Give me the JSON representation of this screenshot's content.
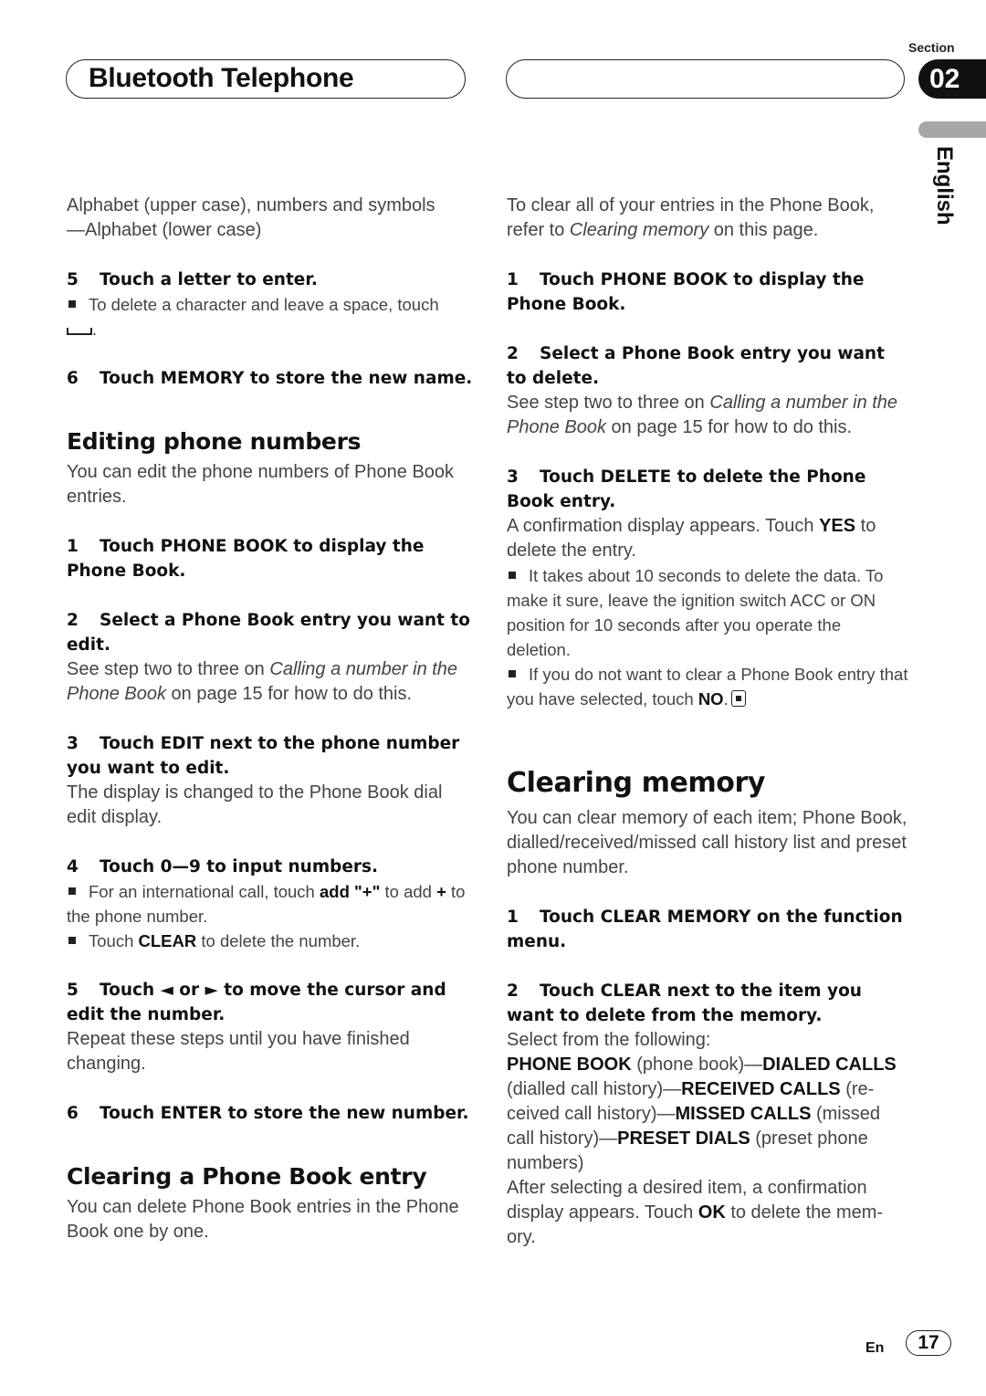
{
  "header": {
    "title": "Bluetooth Telephone",
    "section_label": "Section",
    "section_number": "02",
    "language": "English"
  },
  "left_column": {
    "intro": [
      [
        {
          "t": "Alphabet (upper case), numbers and symbols"
        }
      ],
      [
        {
          "t": "—Alphabet (lower case)"
        }
      ]
    ],
    "step5": {
      "num": "5",
      "text": "Touch a letter to enter."
    },
    "step5_note": [
      {
        "t": "To delete a character and leave a space, touch"
      }
    ],
    "step6": {
      "num": "6",
      "text": "Touch MEMORY to store the new name."
    },
    "editing": {
      "heading": "Editing phone numbers",
      "desc": "You can edit the phone numbers of Phone Book entries.",
      "step1": {
        "num": "1",
        "text": "Touch PHONE BOOK to display the Phone Book."
      },
      "step2": {
        "num": "2",
        "text": "Select a Phone Book entry you want to edit."
      },
      "step2_body": [
        {
          "t": "See step two to three on "
        },
        {
          "t": "Calling a number in the Phone Book",
          "i": true
        },
        {
          "t": " on page 15 for how to do this."
        }
      ],
      "step3": {
        "num": "3",
        "text": "Touch EDIT next to the phone number you want to edit."
      },
      "step3_body": "The display is changed to the Phone Book dial edit display.",
      "step4": {
        "num": "4",
        "text": "Touch 0—9 to input numbers."
      },
      "step4_notes": [
        [
          {
            "t": "For an international call, touch "
          },
          {
            "t": "add \"+\"",
            "b": true
          },
          {
            "t": " to add "
          },
          {
            "t": "+",
            "b": true
          },
          {
            "t": " to the phone number."
          }
        ],
        [
          {
            "t": "Touch "
          },
          {
            "t": "CLEAR",
            "b": true
          },
          {
            "t": " to delete the number."
          }
        ]
      ],
      "step5": {
        "num": "5",
        "text": "Touch ◄ or ► to move the cursor and edit the number."
      },
      "step5_body": "Repeat these steps until you have finished changing.",
      "step6": {
        "num": "6",
        "text": "Touch ENTER to store the new number."
      }
    },
    "clearing_entry": {
      "heading": "Clearing a Phone Book entry",
      "desc": "You can delete Phone Book entries in the Phone Book one by one."
    }
  },
  "right_column": {
    "intro": [
      {
        "t": "To clear all of your entries in the Phone Book, refer to "
      },
      {
        "t": "Clearing memory",
        "i": true
      },
      {
        "t": " on this page."
      }
    ],
    "step1": {
      "num": "1",
      "text": "Touch PHONE BOOK to display the Phone Book."
    },
    "step2": {
      "num": "2",
      "text": "Select a Phone Book entry you want to delete."
    },
    "step2_body": [
      {
        "t": "See step two to three on "
      },
      {
        "t": "Calling a number in the Phone Book",
        "i": true
      },
      {
        "t": " on page 15 for how to do this."
      }
    ],
    "step3": {
      "num": "3",
      "text": "Touch DELETE to delete the Phone Book entry."
    },
    "step3_body": [
      {
        "t": "A confirmation display appears. Touch "
      },
      {
        "t": "YES",
        "b": true
      },
      {
        "t": " to delete the entry."
      }
    ],
    "step3_notes": [
      [
        {
          "t": "It takes about 10 seconds to delete the data. To make it sure, leave the ignition switch ACC or ON position for 10 seconds after you operate the deletion."
        }
      ],
      [
        {
          "t": "If you do not want to clear a Phone Book entry that you have selected, touch "
        },
        {
          "t": "NO",
          "b": true
        },
        {
          "t": "."
        }
      ]
    ],
    "clearing_memory": {
      "heading": "Clearing memory",
      "desc": "You can clear memory of each item; Phone Book, dialled/received/missed call history list and preset phone number.",
      "step1": {
        "num": "1",
        "text": "Touch CLEAR MEMORY on the function menu."
      },
      "step2": {
        "num": "2",
        "text": "Touch CLEAR next to the item you want to delete from the memory."
      },
      "step2_lead": "Select from the following:",
      "step2_items": [
        {
          "t": "PHONE BOOK",
          "b": true
        },
        {
          "t": " (phone book)—"
        },
        {
          "t": "DIALED CALLS",
          "b": true
        },
        {
          "t": " (dialled call history)—"
        },
        {
          "t": "RECEIVED CALLS",
          "b": true
        },
        {
          "t": " (re-ceived call history)—"
        },
        {
          "t": "MISSED CALLS",
          "b": true
        },
        {
          "t": " (missed call history)—"
        },
        {
          "t": "PRESET DIALS",
          "b": true
        },
        {
          "t": " (preset phone numbers)"
        }
      ],
      "step2_after": [
        {
          "t": "After selecting a desired item, a confirmation display appears. Touch "
        },
        {
          "t": "OK",
          "b": true
        },
        {
          "t": " to delete the mem-ory."
        }
      ]
    }
  },
  "footer": {
    "lang_code": "En",
    "page_number": "17"
  },
  "icons": {
    "space_symbol": "space-key-icon",
    "end_of_section": "end-mark-icon",
    "bullet": "square-bullet"
  }
}
